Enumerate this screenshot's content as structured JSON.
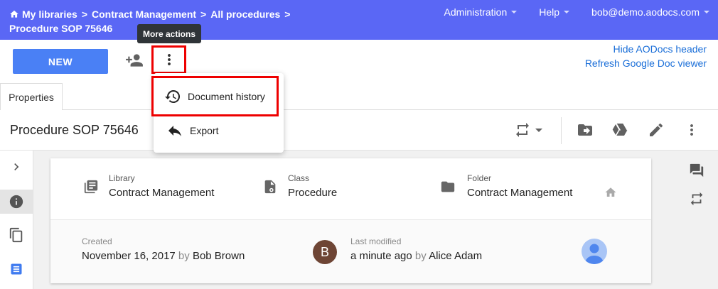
{
  "header": {
    "breadcrumb": {
      "home_icon": "home-icon",
      "items": [
        "My libraries",
        "Contract Management",
        "All procedures"
      ],
      "separator": ">",
      "current": "Procedure SOP 75646"
    },
    "menus": [
      {
        "label": "Administration"
      },
      {
        "label": "Help"
      },
      {
        "label": "bob@demo.aodocs.com"
      }
    ],
    "background_color": "#5a67f5"
  },
  "toolbar": {
    "new_label": "NEW",
    "new_color": "#4a80f5",
    "add_person_icon": "person-add-icon",
    "more_icon": "more-vertical-icon",
    "tooltip": "More actions",
    "links": [
      "Hide AODocs header",
      "Refresh Google Doc viewer"
    ]
  },
  "more_menu": {
    "items": [
      {
        "label": "Document history",
        "icon": "history-icon"
      },
      {
        "label": "Export",
        "icon": "reply-icon"
      }
    ]
  },
  "tabs": [
    {
      "label": "Properties"
    }
  ],
  "document": {
    "title": "Procedure SOP 75646",
    "actions": [
      "sync-icon",
      "move-to-folder-icon",
      "google-drive-icon",
      "edit-pencil-icon",
      "more-vertical-icon"
    ]
  },
  "left_rail": [
    "chevron-right-icon",
    "info-icon",
    "copy-icon",
    "google-doc-icon"
  ],
  "right_rail": [
    "comments-icon",
    "workflow-sync-icon"
  ],
  "properties": {
    "library": {
      "label": "Library",
      "value": "Contract Management"
    },
    "class": {
      "label": "Class",
      "value": "Procedure"
    },
    "folder": {
      "label": "Folder",
      "value": "Contract Management"
    },
    "created": {
      "label": "Created",
      "date": "November 16, 2017",
      "by": "by",
      "user": "Bob Brown",
      "avatar_letter": "B"
    },
    "modified": {
      "label": "Last modified",
      "date": "a minute ago",
      "by": "by",
      "user": "Alice Adam"
    }
  },
  "highlight_color": "#e00000"
}
